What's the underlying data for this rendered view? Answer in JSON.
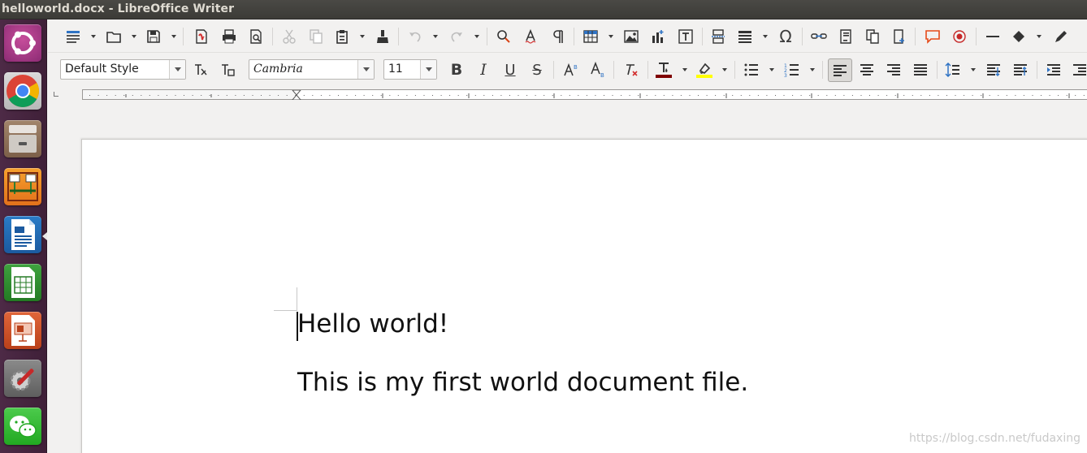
{
  "window": {
    "title": "helloworld.docx - LibreOffice Writer"
  },
  "launcher": {
    "items": [
      {
        "name": "dash-home",
        "icon": "ubuntu-logo-icon"
      },
      {
        "name": "chrome",
        "icon": "chrome-icon"
      },
      {
        "name": "files",
        "icon": "file-cabinet-icon"
      },
      {
        "name": "diagram-app",
        "icon": "flowchart-icon"
      },
      {
        "name": "writer",
        "icon": "writer-icon",
        "active": true
      },
      {
        "name": "calc",
        "icon": "spreadsheet-icon"
      },
      {
        "name": "impress",
        "icon": "presentation-icon"
      },
      {
        "name": "settings",
        "icon": "wrench-gear-icon"
      },
      {
        "name": "wechat",
        "icon": "wechat-icon"
      }
    ]
  },
  "formatting": {
    "paragraph_style": "Default Style",
    "font_name": "Cambria",
    "font_size": "11"
  },
  "colors": {
    "font_color": "#7f0000",
    "highlight_color": "#ffff00",
    "launcher_bg": "#4d2a46",
    "accent": "#e95420"
  },
  "document": {
    "paragraphs": [
      "Hello world!",
      "This is my first world document file."
    ]
  },
  "watermark": "https://blog.csdn.net/fudaxing"
}
